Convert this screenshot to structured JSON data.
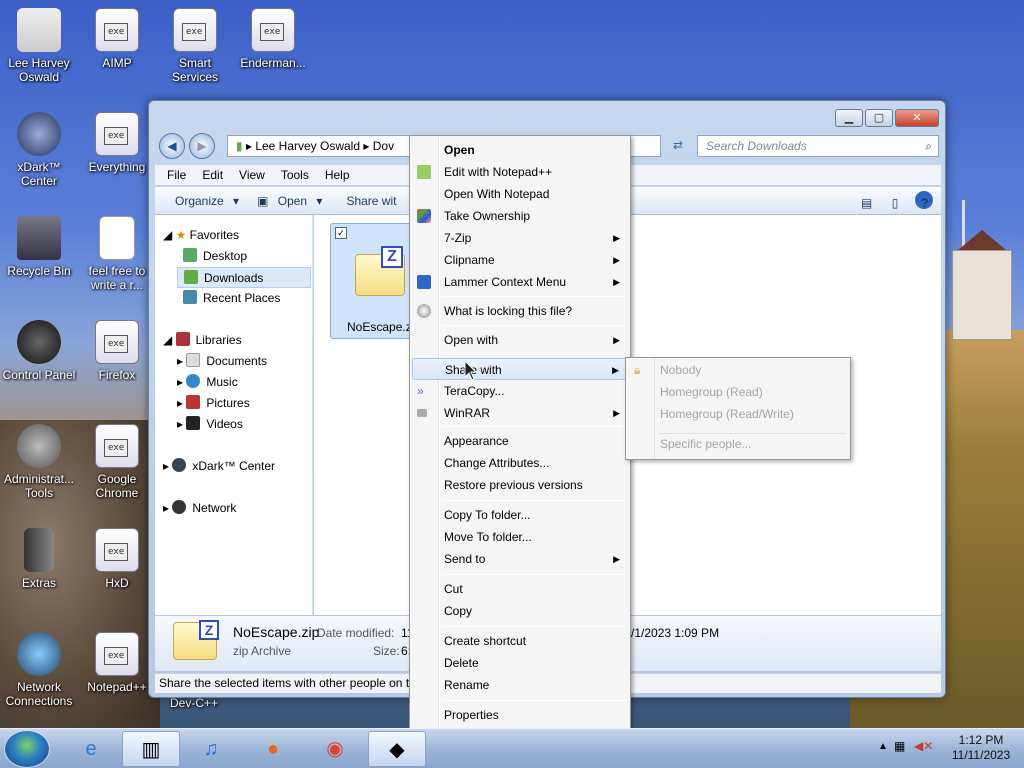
{
  "desktop_icons": [
    {
      "label": "Lee Harvey Oswald"
    },
    {
      "label": "AIMP"
    },
    {
      "label": "Smart Services"
    },
    {
      "label": "Enderman..."
    },
    {
      "label": "xDark™ Center"
    },
    {
      "label": "Everything"
    },
    {
      "label": "Recycle Bin"
    },
    {
      "label": "feel free to write a r..."
    },
    {
      "label": "Control Panel"
    },
    {
      "label": "Firefox"
    },
    {
      "label": "Administrat... Tools"
    },
    {
      "label": "Google Chrome"
    },
    {
      "label": "Extras"
    },
    {
      "label": "HxD"
    },
    {
      "label": "Network Connections"
    },
    {
      "label": "Notepad++"
    },
    {
      "label": "Dev-C++"
    }
  ],
  "window": {
    "address": {
      "user": "Lee Harvey Oswald",
      "folder_partial": "Dov"
    },
    "search_placeholder": "Search Downloads",
    "menubar": [
      "File",
      "Edit",
      "View",
      "Tools",
      "Help"
    ],
    "toolbar": {
      "organize": "Organize",
      "open": "Open",
      "share_partial": "Share wit"
    },
    "nav": {
      "favorites": "Favorites",
      "desktop": "Desktop",
      "downloads": "Downloads",
      "recent": "Recent Places",
      "libraries": "Libraries",
      "documents": "Documents",
      "music": "Music",
      "pictures": "Pictures",
      "videos": "Videos",
      "xdark": "xDark™ Center",
      "network": "Network"
    },
    "file": {
      "name": "NoEscape.zip"
    },
    "details": {
      "name": "NoEscape.zip",
      "type": "zip Archive",
      "modified_label": "Date modified:",
      "modified_value_partial": "11",
      "size_label": "Size:",
      "size_partial": "6:",
      "date_partial": "/1/2023 1:09 PM"
    },
    "status": "Share the selected items with other people on th"
  },
  "context_menu": {
    "items": [
      {
        "label": "Open",
        "bold": true
      },
      {
        "label": "Edit with Notepad++"
      },
      {
        "label": "Open With Notepad"
      },
      {
        "label": "Take Ownership"
      },
      {
        "label": "7-Zip",
        "submenu": true
      },
      {
        "label": "Clipname",
        "submenu": true
      },
      {
        "label": "Lammer Context Menu",
        "submenu": true
      },
      {
        "label": "What is locking this file?"
      },
      {
        "label": "Open with",
        "submenu": true
      },
      {
        "label": "Share with",
        "submenu": true
      },
      {
        "label": "TeraCopy..."
      },
      {
        "label": "WinRAR",
        "submenu": true
      },
      {
        "label": "Appearance"
      },
      {
        "label": "Change Attributes..."
      },
      {
        "label": "Restore previous versions"
      },
      {
        "label": "Copy To folder..."
      },
      {
        "label": "Move To folder..."
      },
      {
        "label": "Send to",
        "submenu": true
      },
      {
        "label": "Cut"
      },
      {
        "label": "Copy"
      },
      {
        "label": "Create shortcut"
      },
      {
        "label": "Delete"
      },
      {
        "label": "Rename"
      },
      {
        "label": "Properties"
      }
    ]
  },
  "share_submenu": {
    "items": [
      "Nobody",
      "Homegroup (Read)",
      "Homegroup (Read/Write)",
      "Specific people..."
    ]
  },
  "taskbar": {
    "time": "1:12 PM",
    "date": "11/11/2023"
  },
  "colors": {
    "accent": "#2d66c4",
    "zip_badge": "#2d4dc0"
  }
}
